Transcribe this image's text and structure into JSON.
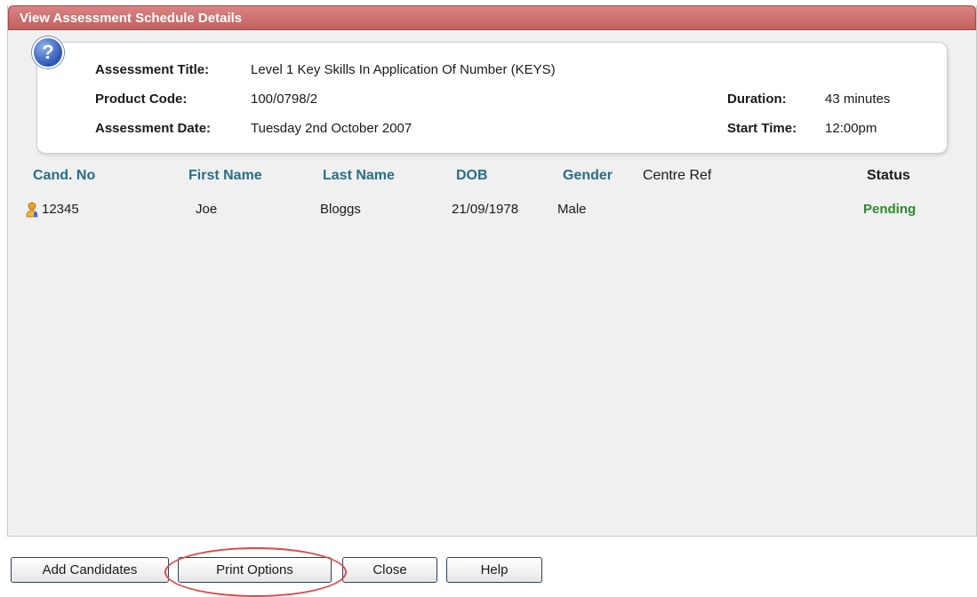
{
  "window": {
    "title": "View Assessment Schedule Details"
  },
  "details": {
    "assessment_title_label": "Assessment Title:",
    "assessment_title_value": "Level 1 Key Skills In Application Of Number (KEYS)",
    "product_code_label": "Product Code:",
    "product_code_value": "100/0798/2",
    "assessment_date_label": "Assessment Date:",
    "assessment_date_value": "Tuesday 2nd October 2007",
    "duration_label": "Duration:",
    "duration_value": "43 minutes",
    "start_time_label": "Start Time:",
    "start_time_value": "12:00pm"
  },
  "table": {
    "headers": [
      "Cand. No",
      "First Name",
      "Last Name",
      "DOB",
      "Gender",
      "Centre Ref",
      "Status"
    ],
    "rows": [
      {
        "cand_no": "12345",
        "first_name": "Joe",
        "last_name": "Bloggs",
        "dob": "21/09/1978",
        "gender": "Male",
        "centre_ref": "",
        "status": "Pending"
      }
    ]
  },
  "buttons": {
    "add_candidates": "Add Candidates",
    "print_options": "Print Options",
    "close": "Close",
    "help": "Help"
  },
  "icons": {
    "help": "question-mark-icon",
    "candidate": "person-icon"
  },
  "colors": {
    "titlebar": "#c96a6a",
    "header_text": "#2a6e84",
    "status_pending": "#2e8b2e",
    "highlight": "#e04848"
  }
}
